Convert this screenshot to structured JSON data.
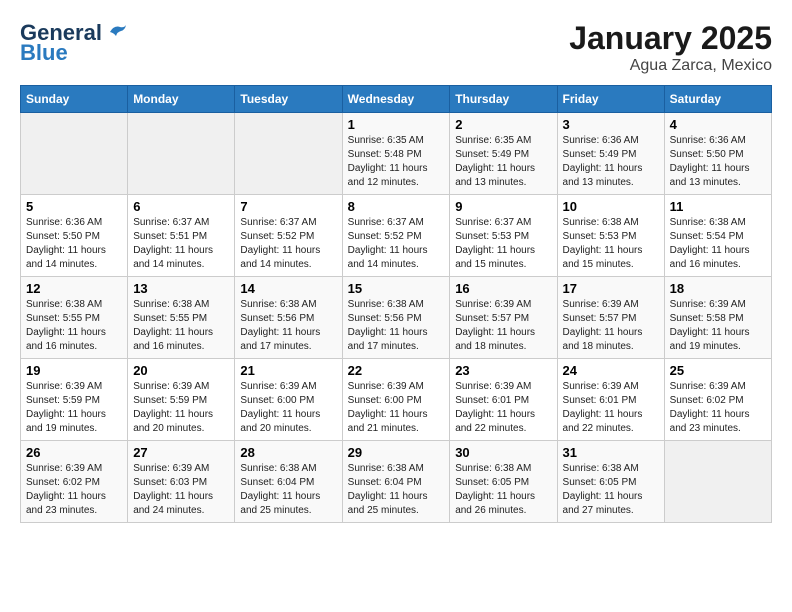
{
  "header": {
    "logo_general": "General",
    "logo_blue": "Blue",
    "title": "January 2025",
    "subtitle": "Agua Zarca, Mexico"
  },
  "days_of_week": [
    "Sunday",
    "Monday",
    "Tuesday",
    "Wednesday",
    "Thursday",
    "Friday",
    "Saturday"
  ],
  "weeks": [
    [
      {
        "day": "",
        "sunrise": "",
        "sunset": "",
        "daylight": "",
        "empty": true
      },
      {
        "day": "",
        "sunrise": "",
        "sunset": "",
        "daylight": "",
        "empty": true
      },
      {
        "day": "",
        "sunrise": "",
        "sunset": "",
        "daylight": "",
        "empty": true
      },
      {
        "day": "1",
        "sunrise": "Sunrise: 6:35 AM",
        "sunset": "Sunset: 5:48 PM",
        "daylight": "Daylight: 11 hours and 12 minutes."
      },
      {
        "day": "2",
        "sunrise": "Sunrise: 6:35 AM",
        "sunset": "Sunset: 5:49 PM",
        "daylight": "Daylight: 11 hours and 13 minutes."
      },
      {
        "day": "3",
        "sunrise": "Sunrise: 6:36 AM",
        "sunset": "Sunset: 5:49 PM",
        "daylight": "Daylight: 11 hours and 13 minutes."
      },
      {
        "day": "4",
        "sunrise": "Sunrise: 6:36 AM",
        "sunset": "Sunset: 5:50 PM",
        "daylight": "Daylight: 11 hours and 13 minutes."
      }
    ],
    [
      {
        "day": "5",
        "sunrise": "Sunrise: 6:36 AM",
        "sunset": "Sunset: 5:50 PM",
        "daylight": "Daylight: 11 hours and 14 minutes."
      },
      {
        "day": "6",
        "sunrise": "Sunrise: 6:37 AM",
        "sunset": "Sunset: 5:51 PM",
        "daylight": "Daylight: 11 hours and 14 minutes."
      },
      {
        "day": "7",
        "sunrise": "Sunrise: 6:37 AM",
        "sunset": "Sunset: 5:52 PM",
        "daylight": "Daylight: 11 hours and 14 minutes."
      },
      {
        "day": "8",
        "sunrise": "Sunrise: 6:37 AM",
        "sunset": "Sunset: 5:52 PM",
        "daylight": "Daylight: 11 hours and 14 minutes."
      },
      {
        "day": "9",
        "sunrise": "Sunrise: 6:37 AM",
        "sunset": "Sunset: 5:53 PM",
        "daylight": "Daylight: 11 hours and 15 minutes."
      },
      {
        "day": "10",
        "sunrise": "Sunrise: 6:38 AM",
        "sunset": "Sunset: 5:53 PM",
        "daylight": "Daylight: 11 hours and 15 minutes."
      },
      {
        "day": "11",
        "sunrise": "Sunrise: 6:38 AM",
        "sunset": "Sunset: 5:54 PM",
        "daylight": "Daylight: 11 hours and 16 minutes."
      }
    ],
    [
      {
        "day": "12",
        "sunrise": "Sunrise: 6:38 AM",
        "sunset": "Sunset: 5:55 PM",
        "daylight": "Daylight: 11 hours and 16 minutes."
      },
      {
        "day": "13",
        "sunrise": "Sunrise: 6:38 AM",
        "sunset": "Sunset: 5:55 PM",
        "daylight": "Daylight: 11 hours and 16 minutes."
      },
      {
        "day": "14",
        "sunrise": "Sunrise: 6:38 AM",
        "sunset": "Sunset: 5:56 PM",
        "daylight": "Daylight: 11 hours and 17 minutes."
      },
      {
        "day": "15",
        "sunrise": "Sunrise: 6:38 AM",
        "sunset": "Sunset: 5:56 PM",
        "daylight": "Daylight: 11 hours and 17 minutes."
      },
      {
        "day": "16",
        "sunrise": "Sunrise: 6:39 AM",
        "sunset": "Sunset: 5:57 PM",
        "daylight": "Daylight: 11 hours and 18 minutes."
      },
      {
        "day": "17",
        "sunrise": "Sunrise: 6:39 AM",
        "sunset": "Sunset: 5:57 PM",
        "daylight": "Daylight: 11 hours and 18 minutes."
      },
      {
        "day": "18",
        "sunrise": "Sunrise: 6:39 AM",
        "sunset": "Sunset: 5:58 PM",
        "daylight": "Daylight: 11 hours and 19 minutes."
      }
    ],
    [
      {
        "day": "19",
        "sunrise": "Sunrise: 6:39 AM",
        "sunset": "Sunset: 5:59 PM",
        "daylight": "Daylight: 11 hours and 19 minutes."
      },
      {
        "day": "20",
        "sunrise": "Sunrise: 6:39 AM",
        "sunset": "Sunset: 5:59 PM",
        "daylight": "Daylight: 11 hours and 20 minutes."
      },
      {
        "day": "21",
        "sunrise": "Sunrise: 6:39 AM",
        "sunset": "Sunset: 6:00 PM",
        "daylight": "Daylight: 11 hours and 20 minutes."
      },
      {
        "day": "22",
        "sunrise": "Sunrise: 6:39 AM",
        "sunset": "Sunset: 6:00 PM",
        "daylight": "Daylight: 11 hours and 21 minutes."
      },
      {
        "day": "23",
        "sunrise": "Sunrise: 6:39 AM",
        "sunset": "Sunset: 6:01 PM",
        "daylight": "Daylight: 11 hours and 22 minutes."
      },
      {
        "day": "24",
        "sunrise": "Sunrise: 6:39 AM",
        "sunset": "Sunset: 6:01 PM",
        "daylight": "Daylight: 11 hours and 22 minutes."
      },
      {
        "day": "25",
        "sunrise": "Sunrise: 6:39 AM",
        "sunset": "Sunset: 6:02 PM",
        "daylight": "Daylight: 11 hours and 23 minutes."
      }
    ],
    [
      {
        "day": "26",
        "sunrise": "Sunrise: 6:39 AM",
        "sunset": "Sunset: 6:02 PM",
        "daylight": "Daylight: 11 hours and 23 minutes."
      },
      {
        "day": "27",
        "sunrise": "Sunrise: 6:39 AM",
        "sunset": "Sunset: 6:03 PM",
        "daylight": "Daylight: 11 hours and 24 minutes."
      },
      {
        "day": "28",
        "sunrise": "Sunrise: 6:38 AM",
        "sunset": "Sunset: 6:04 PM",
        "daylight": "Daylight: 11 hours and 25 minutes."
      },
      {
        "day": "29",
        "sunrise": "Sunrise: 6:38 AM",
        "sunset": "Sunset: 6:04 PM",
        "daylight": "Daylight: 11 hours and 25 minutes."
      },
      {
        "day": "30",
        "sunrise": "Sunrise: 6:38 AM",
        "sunset": "Sunset: 6:05 PM",
        "daylight": "Daylight: 11 hours and 26 minutes."
      },
      {
        "day": "31",
        "sunrise": "Sunrise: 6:38 AM",
        "sunset": "Sunset: 6:05 PM",
        "daylight": "Daylight: 11 hours and 27 minutes."
      },
      {
        "day": "",
        "sunrise": "",
        "sunset": "",
        "daylight": "",
        "empty": true
      }
    ]
  ]
}
